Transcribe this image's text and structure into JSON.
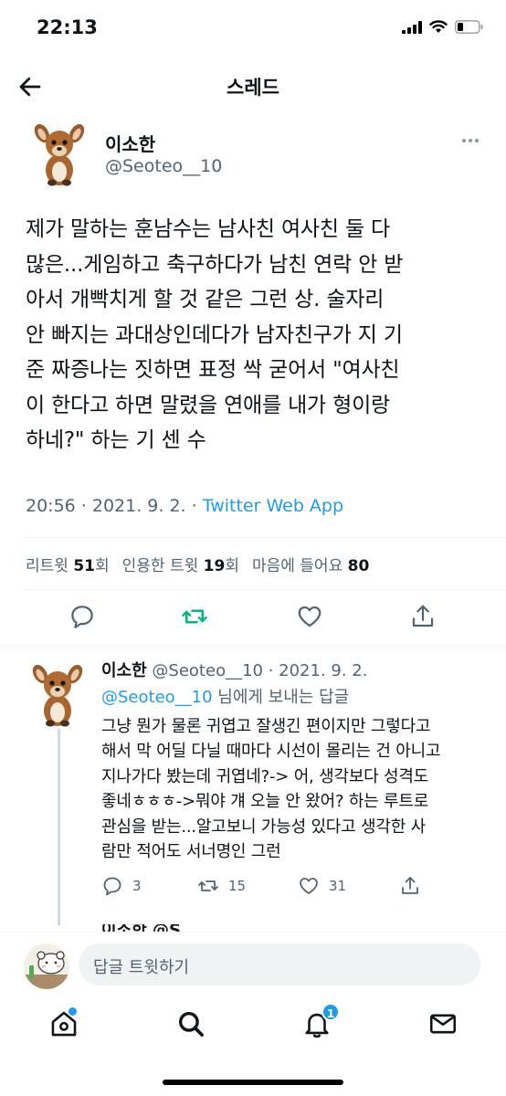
{
  "status_bar": {
    "time": "22:13"
  },
  "nav": {
    "title": "스레드",
    "back_icon": "arrow-left-icon"
  },
  "tweet": {
    "name": "이소한",
    "handle": "@Seoteo__10",
    "text": "제가 말하는 훈남수는 남사친 여사친 둘 다\n많은...게임하고 축구하다가 남친 연락 안 받\n아서 개빡치게 할 것 같은 그런 상. 술자리\n안 빠지는 과대상인데다가 남자친구가 지 기\n준 짜증나는 짓하면 표정 싹 굳어서 \"여사친\n이 한다고 하면 말렸을 연애를 내가 형이랑\n하네?\" 하는 기 센 수",
    "meta_time": "20:56 · 2021. 9. 2. · ",
    "meta_app": "Twitter Web App",
    "stats": {
      "retweets_label": "리트윗",
      "retweets_count": "51",
      "retweets_unit": "회",
      "quotes_label": "인용한 트윗",
      "quotes_count": "19",
      "quotes_unit": "회",
      "likes_label": "마음에 들어요",
      "likes_count": "80"
    }
  },
  "reply": {
    "name": "이소한",
    "handle_date": "@Seoteo__10 · 2021. 9. 2.",
    "mention": "@Seoteo__10",
    "reply_to_suffix": " 님에게 보내는 답글",
    "text": "그냥 뭔가 물론 귀엽고 잘생긴 편이지만 그렇다고\n해서 막 어딜 다닐 때마다 시선이 몰리는 건 아니고\n지나가다 봤는데 귀엽네?-> 어, 생각보다 성격도\n좋네ㅎㅎㅎ->뭐야 걔 오늘 안 왔어? 하는 루트로\n관심을 받는...알고보니 가능성 있다고 생각한 사\n람만 적어도 서너명인 그런",
    "replies": "3",
    "retweets": "15",
    "likes": "31",
    "next_peek": "이소한 @S"
  },
  "compose": {
    "placeholder": "답글 트윗하기"
  },
  "tabs": {
    "notifications_badge": "1"
  },
  "colors": {
    "accent": "#1d9bf0",
    "retweet_green": "#00ba7c",
    "secondary": "#536471"
  }
}
